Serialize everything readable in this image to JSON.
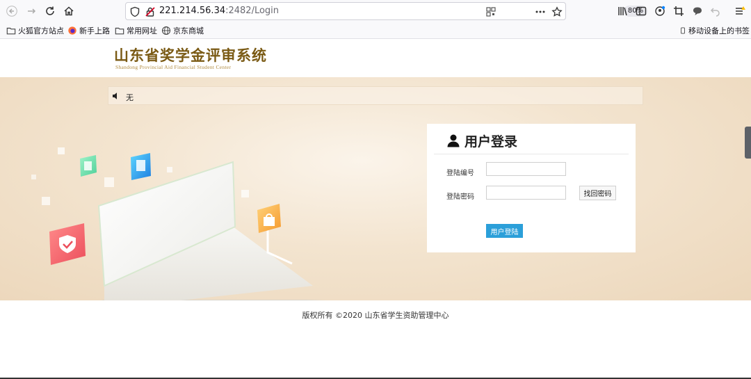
{
  "browser": {
    "url_host": "221.214.56.34",
    "url_rest": ":2482/Login",
    "zoom": "80%",
    "bookmarks": [
      {
        "label": "火狐官方站点",
        "icon": "folder-icon"
      },
      {
        "label": "新手上路",
        "icon": "firefox-icon"
      },
      {
        "label": "常用网址",
        "icon": "folder-icon"
      },
      {
        "label": "京东商城",
        "icon": "globe-icon"
      }
    ],
    "mobile_bookmarks": "移动设备上的书签"
  },
  "header": {
    "title": "山东省奖学金评审系统",
    "subtitle": "Shandong Provincial Aid Financial Student Center"
  },
  "notice": {
    "icon": "speaker-icon",
    "text": "无"
  },
  "login": {
    "icon": "user-icon",
    "title": "用户登录",
    "username_label": "登陆编号",
    "username_value": "",
    "password_label": "登陆密码",
    "password_value": "",
    "find_password_label": "找回密码",
    "submit_label": "用户登陆"
  },
  "footer": {
    "copyright": "版权所有 ©2020 山东省学生资助管理中心"
  },
  "colors": {
    "brand": "#7a5a14",
    "submit_button": "#2b9fd9",
    "hero_background": "#f3e4cf"
  }
}
